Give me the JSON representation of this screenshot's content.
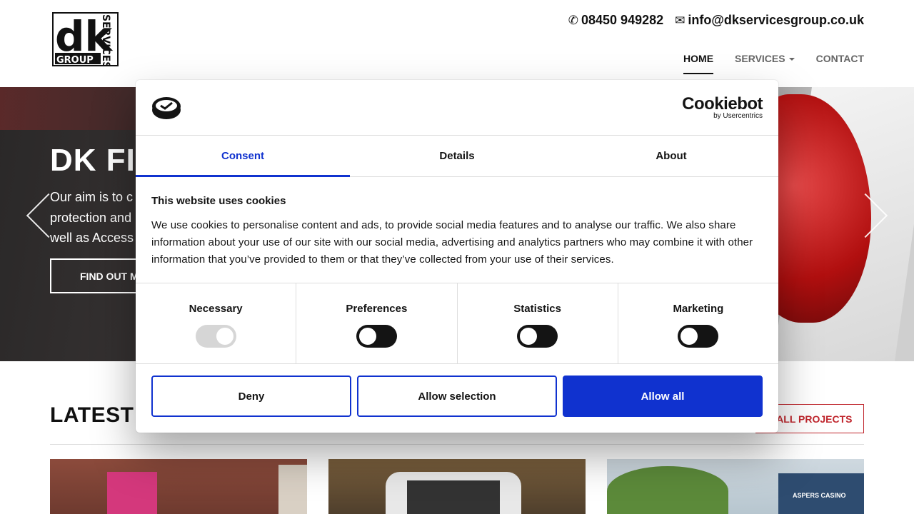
{
  "header": {
    "logo_text": {
      "main": "dk",
      "side": "SERVICES",
      "bottom": "GROUP"
    },
    "phone": "08450 949282",
    "email": "info@dkservicesgroup.co.uk",
    "nav": [
      {
        "label": "HOME",
        "active": true
      },
      {
        "label": "SERVICES",
        "has_dropdown": true
      },
      {
        "label": "CONTACT"
      }
    ]
  },
  "hero": {
    "title_visible": "DK FIRE",
    "text_lines": [
      "Our aim is to c",
      "protection and",
      "well as Access"
    ],
    "button_label": "FIND OUT M"
  },
  "projects": {
    "title_visible": "LATEST PRO",
    "see_all_label": "E ALL PROJECTS",
    "thumb3_sign": "ASPERS CASINO"
  },
  "cookie_dialog": {
    "brand_name": "Cookiebot",
    "brand_sub": "by Usercentrics",
    "tabs": [
      {
        "label": "Consent",
        "active": true
      },
      {
        "label": "Details"
      },
      {
        "label": "About"
      }
    ],
    "heading": "This website uses cookies",
    "body": "We use cookies to personalise content and ads, to provide social media features and to analyse our traffic. We also share information about your use of our site with our social media, advertising and analytics partners who may combine it with other information that you’ve provided to them or that they’ve collected from your use of their services.",
    "categories": [
      {
        "label": "Necessary",
        "state": "on-disabled"
      },
      {
        "label": "Preferences",
        "state": "off"
      },
      {
        "label": "Statistics",
        "state": "off"
      },
      {
        "label": "Marketing",
        "state": "off"
      }
    ],
    "buttons": {
      "deny": "Deny",
      "allow_selection": "Allow selection",
      "allow_all": "Allow all"
    },
    "accent_color": "#1032cf"
  },
  "colors": {
    "brand_red": "#c0262d"
  }
}
